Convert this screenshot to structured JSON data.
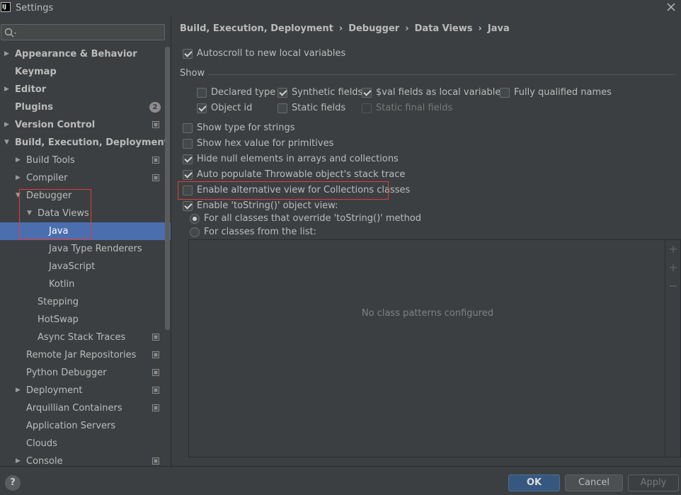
{
  "window": {
    "title": "Settings",
    "app_icon_text": "IJ"
  },
  "search": {
    "placeholder": ""
  },
  "sidebar": {
    "items": [
      {
        "label": "Appearance & Behavior",
        "bold": true,
        "arrow": "right"
      },
      {
        "label": "Keymap",
        "bold": true
      },
      {
        "label": "Editor",
        "bold": true,
        "arrow": "right"
      },
      {
        "label": "Plugins",
        "bold": true,
        "badge": "2"
      },
      {
        "label": "Version Control",
        "bold": true,
        "arrow": "right",
        "project_icon": true
      },
      {
        "label": "Build, Execution, Deployment",
        "bold": true,
        "arrow": "down"
      },
      {
        "label": "Build Tools",
        "arrow": "right",
        "project_icon": true
      },
      {
        "label": "Compiler",
        "arrow": "right",
        "project_icon": true
      },
      {
        "label": "Debugger",
        "arrow": "down"
      },
      {
        "label": "Data Views",
        "arrow": "down"
      },
      {
        "label": "Java",
        "selected": true
      },
      {
        "label": "Java Type Renderers"
      },
      {
        "label": "JavaScript"
      },
      {
        "label": "Kotlin"
      },
      {
        "label": "Stepping"
      },
      {
        "label": "HotSwap"
      },
      {
        "label": "Async Stack Traces",
        "project_icon": true
      },
      {
        "label": "Remote Jar Repositories",
        "project_icon": true
      },
      {
        "label": "Python Debugger",
        "project_icon": true
      },
      {
        "label": "Deployment",
        "arrow": "right",
        "project_icon": true
      },
      {
        "label": "Arquillian Containers",
        "project_icon": true
      },
      {
        "label": "Application Servers"
      },
      {
        "label": "Clouds"
      },
      {
        "label": "Console",
        "arrow": "right",
        "project_icon": true
      }
    ]
  },
  "breadcrumb": [
    "Build, Execution, Deployment",
    "Debugger",
    "Data Views",
    "Java"
  ],
  "options": {
    "autoscroll": {
      "label": "Autoscroll to new local variables",
      "checked": true
    },
    "show_group": "Show",
    "declared_type": {
      "label": "Declared type",
      "checked": false
    },
    "synthetic_fields": {
      "label": "Synthetic fields",
      "checked": true
    },
    "val_fields": {
      "label": "$val fields as local variables",
      "checked": true
    },
    "fully_qualified": {
      "label": "Fully qualified names",
      "checked": false
    },
    "object_id": {
      "label": "Object id",
      "checked": true
    },
    "static_fields": {
      "label": "Static fields",
      "checked": false
    },
    "static_final_fields": {
      "label": "Static final fields",
      "checked": false,
      "disabled": true
    },
    "type_for_strings": {
      "label": "Show type for strings",
      "checked": false
    },
    "hex_primitives": {
      "label": "Show hex value for primitives",
      "checked": false
    },
    "hide_null": {
      "label": "Hide null elements in arrays and collections",
      "checked": true
    },
    "throwable_trace": {
      "label": "Auto populate Throwable object's stack trace",
      "checked": true
    },
    "alt_collections": {
      "label": "Enable alternative view for Collections classes",
      "checked": false
    },
    "tostring_view": {
      "label": "Enable 'toString()' object view:",
      "checked": true
    },
    "radio_all": {
      "label": "For all classes that override 'toString()' method",
      "checked": true
    },
    "radio_list": {
      "label": "For classes from the list:",
      "checked": false
    }
  },
  "class_list": {
    "empty_text": "No class patterns configured"
  },
  "footer": {
    "ok": "OK",
    "cancel": "Cancel",
    "apply": "Apply",
    "help": "?"
  },
  "colors": {
    "selection": "#4b6eaf",
    "highlight_box": "#e03c3c",
    "background": "#3c3f41"
  }
}
